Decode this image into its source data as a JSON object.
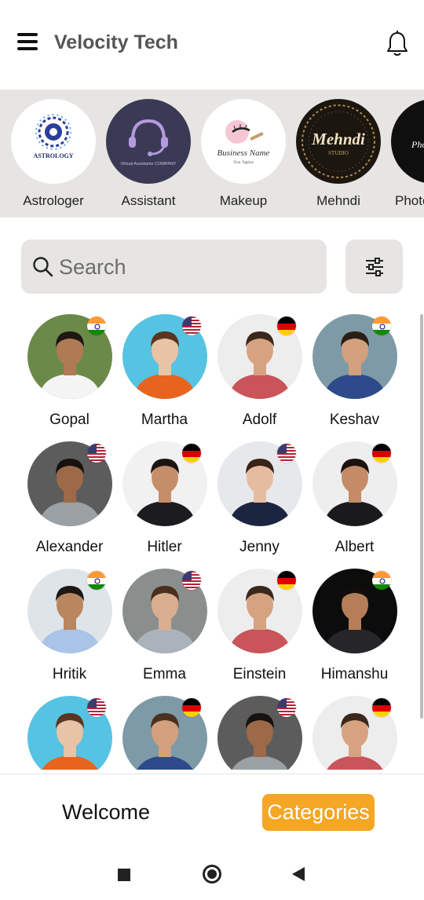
{
  "header": {
    "title": "Velocity Tech",
    "menu_icon": "hamburger-menu-icon",
    "notification_icon": "bell-icon"
  },
  "categories": [
    {
      "label": "Astrologer",
      "logo_text": "ASTROLOGY"
    },
    {
      "label": "Assistant",
      "logo_text": "Virtual Assistants COMPANY"
    },
    {
      "label": "Makeup",
      "logo_text": "Business Name"
    },
    {
      "label": "Mehndi",
      "logo_text": "Mehndi"
    },
    {
      "label": "Photo",
      "logo_text": "Pho"
    }
  ],
  "search": {
    "placeholder": "Search",
    "value": ""
  },
  "filter_icon": "sliders-icon",
  "people": [
    {
      "name": "Gopal",
      "flag": "india",
      "bg": "#6b8a4a",
      "shirt": "#f4f4f4",
      "skin": "#b07a55",
      "hair": "#1e1712"
    },
    {
      "name": "Martha",
      "flag": "usa",
      "bg": "#56c3e2",
      "shirt": "#e8631e",
      "skin": "#e9c3a6",
      "hair": "#5b3520"
    },
    {
      "name": "Adolf",
      "flag": "germany",
      "bg": "#ededed",
      "shirt": "#c9545a",
      "skin": "#d6a27f",
      "hair": "#3a281c"
    },
    {
      "name": "Keshav",
      "flag": "india",
      "bg": "#7e9aa7",
      "shirt": "#2f4a8a",
      "skin": "#d2a07c",
      "hair": "#2a1e16"
    },
    {
      "name": "Alexander",
      "flag": "usa",
      "bg": "#5c5c5c",
      "shirt": "#9aa0a4",
      "skin": "#9c6a48",
      "hair": "#151210"
    },
    {
      "name": "Hitler",
      "flag": "germany",
      "bg": "#f1f1f1",
      "shirt": "#1c1c1e",
      "skin": "#c58e6b",
      "hair": "#1d1410"
    },
    {
      "name": "Jenny",
      "flag": "usa",
      "bg": "#e6e8ec",
      "shirt": "#1c2540",
      "skin": "#e6bca0",
      "hair": "#3a2418"
    },
    {
      "name": "Albert",
      "flag": "germany",
      "bg": "#eeeeee",
      "shirt": "#1a1a1c",
      "skin": "#c48b66",
      "hair": "#1c120d"
    },
    {
      "name": "Hritik",
      "flag": "india",
      "bg": "#dfe4e8",
      "shirt": "#a9c4e6",
      "skin": "#b98660",
      "hair": "#1e1712"
    },
    {
      "name": "Emma",
      "flag": "usa",
      "bg": "#8a8f8e",
      "shirt": "#aab3bc",
      "skin": "#d9ae90",
      "hair": "#4a2e1e"
    },
    {
      "name": "Einstein",
      "flag": "germany",
      "bg": "#ededed",
      "shirt": "#c9545a",
      "skin": "#d6a27f",
      "hair": "#3a281c"
    },
    {
      "name": "Himanshu",
      "flag": "india",
      "bg": "#0c0c0c",
      "shirt": "#26262a",
      "skin": "#b57d58",
      "hair": "#120d0a"
    },
    {
      "name": "",
      "flag": "usa",
      "bg": "#56c3e2",
      "shirt": "#e8631e",
      "skin": "#e9c3a6",
      "hair": "#5b3520"
    },
    {
      "name": "",
      "flag": "germany",
      "bg": "#7e9aa7",
      "shirt": "#2f4a8a",
      "skin": "#d2a07c",
      "hair": "#4a3020"
    },
    {
      "name": "",
      "flag": "usa",
      "bg": "#5c5c5c",
      "shirt": "#9aa0a4",
      "skin": "#9c6a48",
      "hair": "#151210"
    },
    {
      "name": "",
      "flag": "germany",
      "bg": "#ededed",
      "shirt": "#c9545a",
      "skin": "#d6a27f",
      "hair": "#3a281c"
    }
  ],
  "bottom_nav": {
    "welcome_label": "Welcome",
    "categories_label": "Categories"
  },
  "colors": {
    "accent": "#f5a623",
    "strip_bg": "#e6e5e3",
    "title": "#555555"
  }
}
